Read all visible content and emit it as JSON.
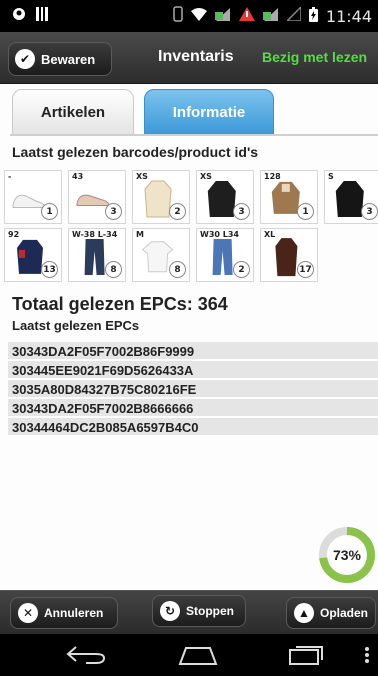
{
  "statusbar": {
    "time": "11:44"
  },
  "actionbar": {
    "save_label": "Bewaren",
    "title": "Inventaris",
    "status": "Bezig met lezen"
  },
  "tabs": [
    {
      "label": "Artikelen",
      "active": false
    },
    {
      "label": "Informatie",
      "active": true
    }
  ],
  "barcodes": {
    "label": "Laatst gelezen barcodes/product id's",
    "row1": [
      {
        "size": "-",
        "count": "1",
        "item": "shoe-white"
      },
      {
        "size": "43",
        "count": "3",
        "item": "shoe-tan"
      },
      {
        "size": "XS",
        "count": "2",
        "item": "coat-beige"
      },
      {
        "size": "XS",
        "count": "3",
        "item": "jacket-black"
      },
      {
        "size": "128",
        "count": "1",
        "item": "jacket-brown"
      },
      {
        "size": "S",
        "count": "3",
        "item": "sweater-black"
      }
    ],
    "row2": [
      {
        "size": "92",
        "count": "13",
        "item": "vest-navy"
      },
      {
        "size": "W-38 L-34",
        "count": "8",
        "item": "jeans-dark"
      },
      {
        "size": "M",
        "count": "8",
        "item": "shirt-white"
      },
      {
        "size": "W30 L34",
        "count": "2",
        "item": "jeans-blue"
      },
      {
        "size": "XL",
        "count": "17",
        "item": "coat-brown"
      }
    ]
  },
  "epcs": {
    "total_label": "Totaal gelezen EPCs: 364",
    "list_label": "Laatst gelezen EPCs",
    "items": [
      "30343DA2F05F7002B86F9999",
      "303445EE9021F69D5626433A",
      "3035A80D84327B75C80216FE",
      "30343DA2F05F7002B8666666",
      "30344464DC2B085A6597B4C0"
    ]
  },
  "progress": {
    "value": 73,
    "label": "73%"
  },
  "bottombar": {
    "cancel_label": "Annuleren",
    "stop_label": "Stoppen",
    "upload_label": "Opladen"
  },
  "colors": {
    "accent_blue": "#3d99d8",
    "status_green": "#55dd44",
    "progress_green": "#8bc34a"
  }
}
